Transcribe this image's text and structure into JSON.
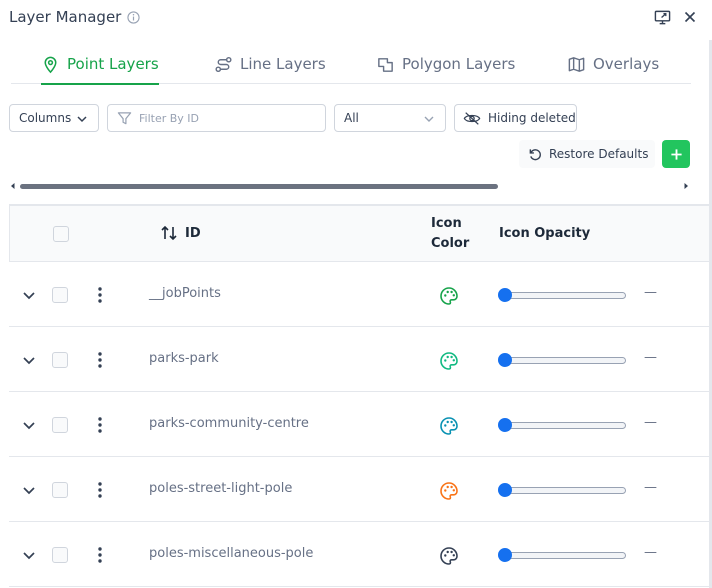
{
  "panel": {
    "title": "Layer Manager"
  },
  "tabs": [
    {
      "label": "Point Layers",
      "active": true
    },
    {
      "label": "Line Layers",
      "active": false
    },
    {
      "label": "Polygon Layers",
      "active": false
    },
    {
      "label": "Overlays",
      "active": false
    }
  ],
  "toolbar": {
    "columns_label": "Columns",
    "filter_placeholder": "Filter By ID",
    "filter_value": "",
    "status_select": "All",
    "hiding_deleted_label": "Hiding deleted",
    "restore_defaults_label": "Restore Defaults"
  },
  "table": {
    "headers": {
      "id": "ID",
      "icon_color_line1": "Icon",
      "icon_color_line2": "Color",
      "icon_opacity": "Icon Opacity"
    },
    "rows": [
      {
        "id": "__jobPoints",
        "icon_color": "#16a34a",
        "icon_opacity_display": "—"
      },
      {
        "id": "parks-park",
        "icon_color": "#10b981",
        "icon_opacity_display": "—"
      },
      {
        "id": "parks-community-centre",
        "icon_color": "#0891b2",
        "icon_opacity_display": "—"
      },
      {
        "id": "poles-street-light-pole",
        "icon_color": "#f97316",
        "icon_opacity_display": "—"
      },
      {
        "id": "poles-miscellaneous-pole",
        "icon_color": "#344054",
        "icon_opacity_display": "—"
      }
    ]
  },
  "colors": {
    "accent": "#16a34a",
    "add_button": "#22c55e",
    "slider_thumb": "#1570ef"
  }
}
